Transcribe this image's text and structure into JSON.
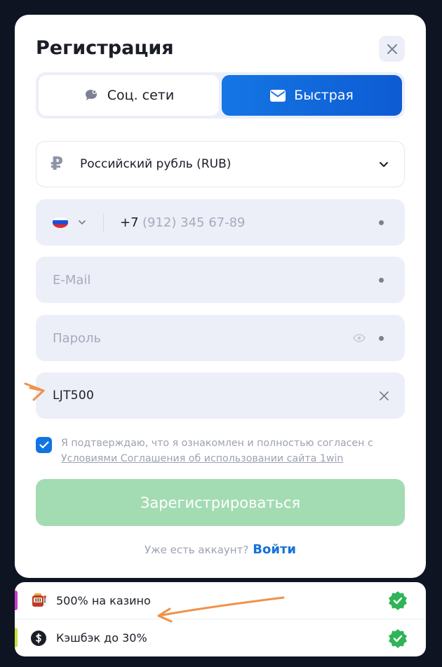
{
  "modal": {
    "title": "Регистрация"
  },
  "tabs": [
    {
      "label": "Соц. сети",
      "icon": "chat-bubble-icon",
      "active": false
    },
    {
      "label": "Быстрая",
      "icon": "envelope-icon",
      "active": true
    }
  ],
  "form": {
    "currency": {
      "value": "Российский рубль (RUB)",
      "icon": "ruble-icon"
    },
    "phone": {
      "country_code": "+7",
      "placeholder": "(912) 345 67-89",
      "flag": "russia-flag"
    },
    "email": {
      "placeholder": "E-Mail"
    },
    "password": {
      "placeholder": "Пароль"
    },
    "promo": {
      "value": "LJT500"
    },
    "agreement": {
      "checked": true,
      "text": "Я подтверждаю, что я ознакомлен и полностью согласен с",
      "link": "Условиями Соглашения об использовании сайта 1win"
    },
    "submit_label": "Зарегистрироваться",
    "login_prompt": "Уже есть аккаунт?",
    "login_link": "Войти"
  },
  "bonuses": [
    {
      "label": "500% на казино",
      "icon": "slot-machine-icon",
      "accent": "#c83bd1"
    },
    {
      "label": "Кэшбэк до 30%",
      "icon": "cashback-coin-icon",
      "accent": "#c7e03a"
    }
  ],
  "colors": {
    "accent_blue": "#1274e3",
    "submit_disabled": "#a3dbb2",
    "check_green": "#2fb457",
    "annotation_orange": "#f0914a"
  }
}
